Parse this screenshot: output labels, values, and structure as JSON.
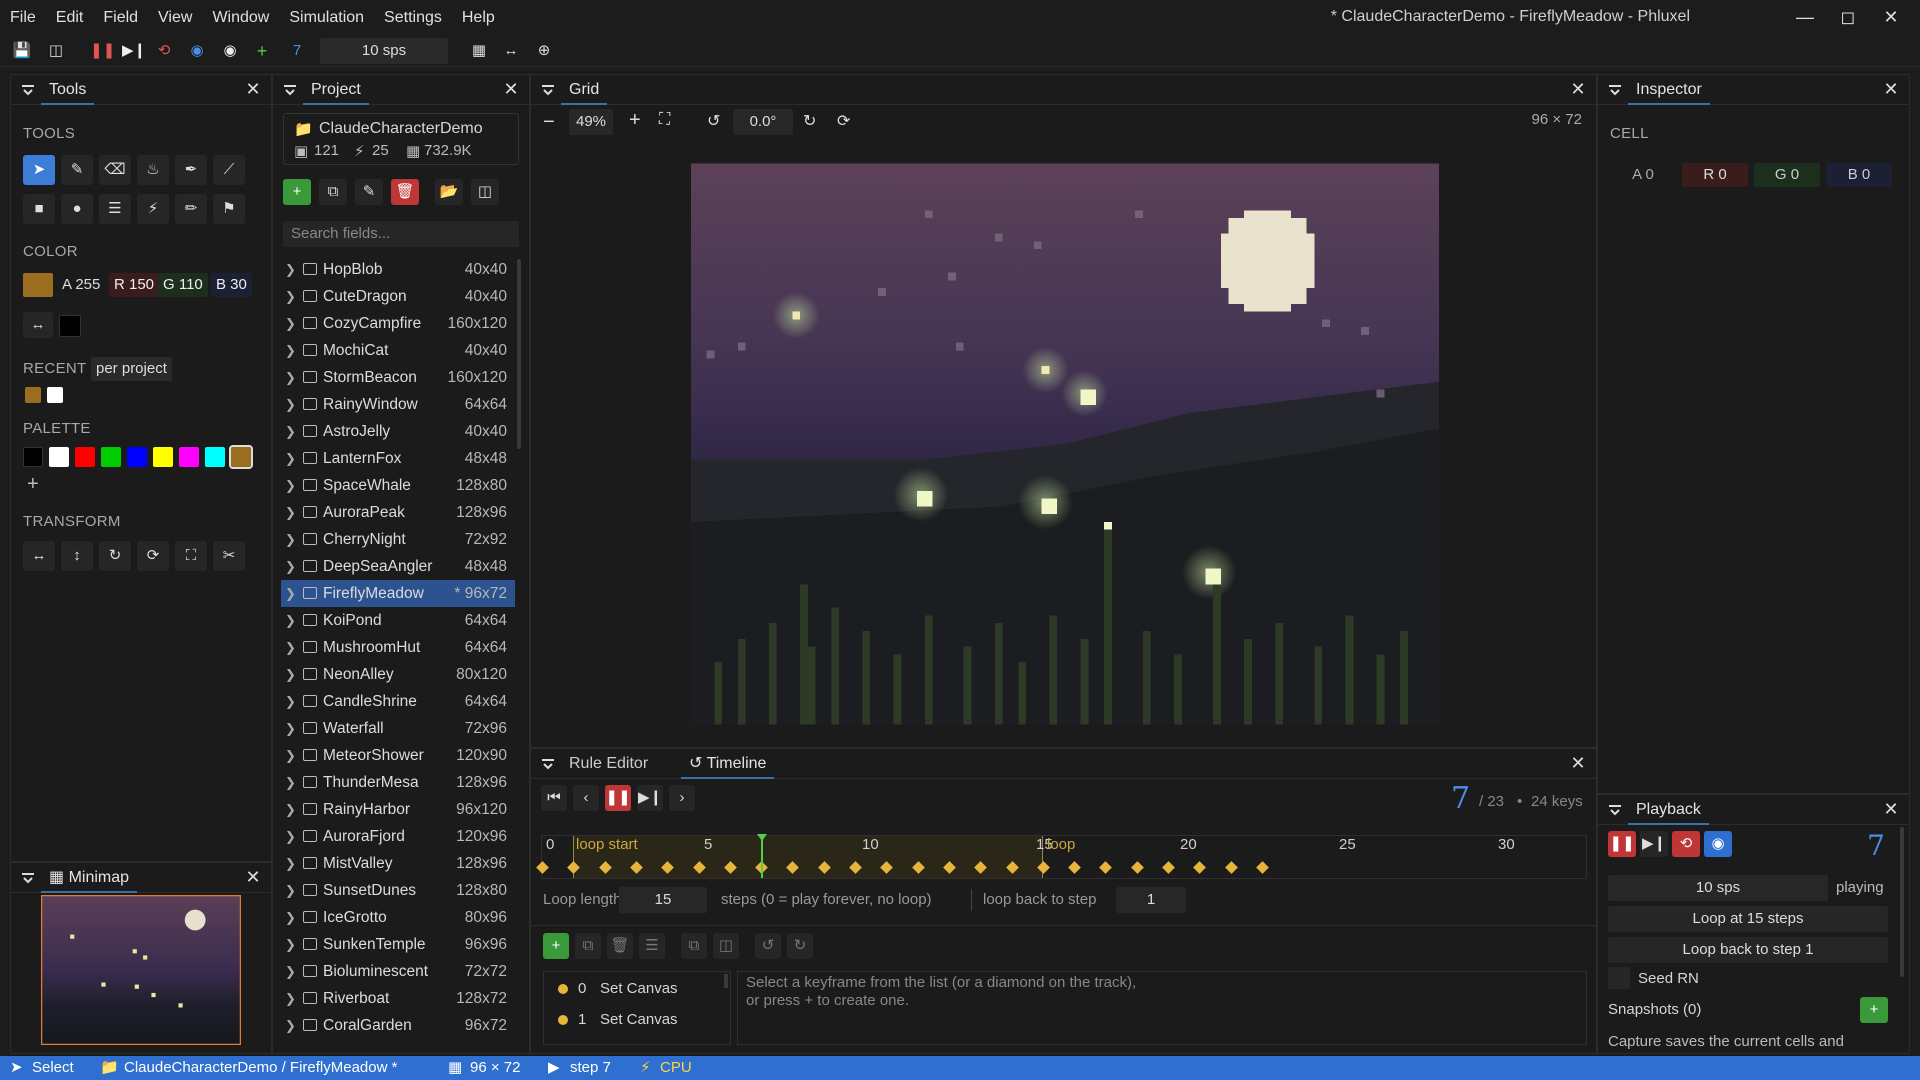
{
  "menu": [
    "File",
    "Edit",
    "Field",
    "View",
    "Window",
    "Simulation",
    "Settings",
    "Help"
  ],
  "window_title": "* ClaudeCharacterDemo - FireflyMeadow - Phluxel",
  "toolbar": {
    "step": "7",
    "speed": "10 sps"
  },
  "tools_panel": {
    "title": "Tools",
    "tools_label": "TOOLS",
    "color_label": "COLOR",
    "a": "A 255",
    "r": "R 150",
    "g": "G 110",
    "b": "B 30",
    "recent_label": "RECENT",
    "recent_mode": "per project",
    "palette_label": "PALETTE",
    "transform_label": "TRANSFORM",
    "accent": "#a87a1e"
  },
  "minimap": {
    "title": "Minimap"
  },
  "project": {
    "title": "Project",
    "name": "ClaudeCharacterDemo",
    "count_images": "121",
    "count_rules": "25",
    "size": "732.9K",
    "search_placeholder": "Search fields...",
    "items": [
      {
        "name": "HopBlob",
        "dim": "40x40"
      },
      {
        "name": "CuteDragon",
        "dim": "40x40"
      },
      {
        "name": "CozyCampfire",
        "dim": "160x120"
      },
      {
        "name": "MochiCat",
        "dim": "40x40"
      },
      {
        "name": "StormBeacon",
        "dim": "160x120"
      },
      {
        "name": "RainyWindow",
        "dim": "64x64"
      },
      {
        "name": "AstroJelly",
        "dim": "40x40"
      },
      {
        "name": "LanternFox",
        "dim": "48x48"
      },
      {
        "name": "SpaceWhale",
        "dim": "128x80"
      },
      {
        "name": "AuroraPeak",
        "dim": "128x96"
      },
      {
        "name": "CherryNight",
        "dim": "72x92"
      },
      {
        "name": "DeepSeaAngler",
        "dim": "48x48"
      },
      {
        "name": "FireflyMeadow",
        "dim": "* 96x72"
      },
      {
        "name": "KoiPond",
        "dim": "64x64"
      },
      {
        "name": "MushroomHut",
        "dim": "64x64"
      },
      {
        "name": "NeonAlley",
        "dim": "80x120"
      },
      {
        "name": "CandleShrine",
        "dim": "64x64"
      },
      {
        "name": "Waterfall",
        "dim": "72x96"
      },
      {
        "name": "MeteorShower",
        "dim": "120x90"
      },
      {
        "name": "ThunderMesa",
        "dim": "128x96"
      },
      {
        "name": "RainyHarbor",
        "dim": "96x120"
      },
      {
        "name": "AuroraFjord",
        "dim": "120x96"
      },
      {
        "name": "MistValley",
        "dim": "128x96"
      },
      {
        "name": "SunsetDunes",
        "dim": "128x80"
      },
      {
        "name": "IceGrotto",
        "dim": "80x96"
      },
      {
        "name": "SunkenTemple",
        "dim": "96x96"
      },
      {
        "name": "Bioluminescent",
        "dim": "72x72"
      },
      {
        "name": "Riverboat",
        "dim": "128x72"
      },
      {
        "name": "CoralGarden",
        "dim": "96x72"
      }
    ]
  },
  "grid": {
    "title": "Grid",
    "zoom": "49%",
    "rotation": "0.0°",
    "size": "96 × 72"
  },
  "inspector": {
    "title": "Inspector",
    "cell_label": "CELL",
    "a": "A 0",
    "r": "R 0",
    "g": "G 0",
    "b": "B 0"
  },
  "timeline": {
    "tab_rule": "Rule Editor",
    "tab_timeline": "Timeline",
    "step": "7",
    "total": "/ 23",
    "keys": "24 keys",
    "loop_start": "loop start",
    "loop_end": "loop",
    "ticks": [
      "0",
      "5",
      "10",
      "15",
      "20",
      "25",
      "30"
    ],
    "loop_length_label": "Loop length",
    "loop_length": "15",
    "steps_hint": "steps  (0 = play forever, no loop)",
    "loop_back_label": "loop back to step",
    "loop_back": "1",
    "keyframes": [
      {
        "idx": "0",
        "label": "Set Canvas"
      },
      {
        "idx": "1",
        "label": "Set Canvas"
      }
    ],
    "hint1": "Select a keyframe from the list (or a diamond on the track),",
    "hint2": "or press + to create one."
  },
  "playback": {
    "title": "Playback",
    "step": "7",
    "speed": "10 sps",
    "state": "playing",
    "loop_at": "Loop at 15 steps",
    "loop_back": "Loop back to step 1",
    "seed": "Seed RN",
    "snapshots": "Snapshots (0)",
    "capture": "Capture saves the current cells and"
  },
  "status": {
    "tool": "Select",
    "path": "ClaudeCharacterDemo  /  FireflyMeadow *",
    "size": "96 × 72",
    "step": "step 7",
    "backend": "CPU"
  }
}
